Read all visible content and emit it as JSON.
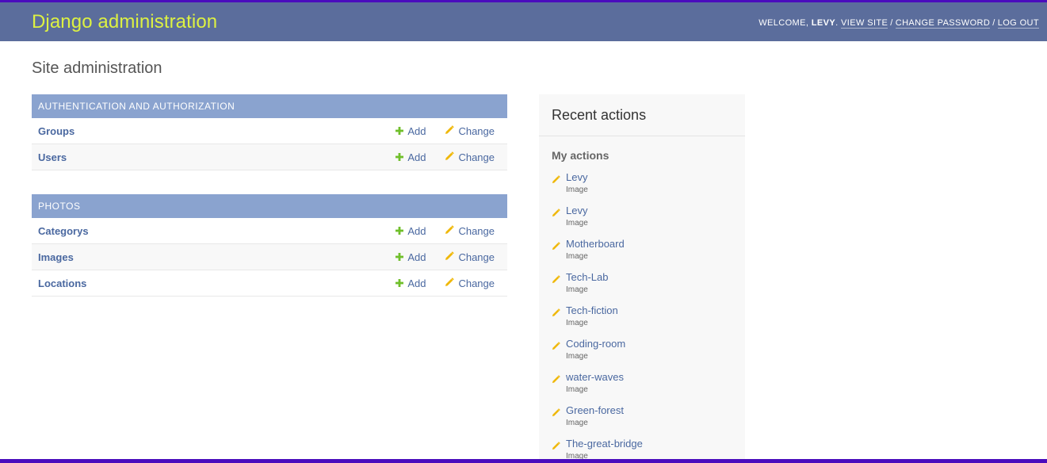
{
  "header": {
    "branding": "Django administration",
    "welcome_label": "Welcome,",
    "username": "Levy",
    "view_site": "View site",
    "change_password": "Change password",
    "log_out": "Log out"
  },
  "page_title": "Site administration",
  "modules": [
    {
      "caption": "Authentication and Authorization",
      "models": [
        {
          "name": "Groups",
          "add": "Add",
          "change": "Change"
        },
        {
          "name": "Users",
          "add": "Add",
          "change": "Change"
        }
      ]
    },
    {
      "caption": "Photos",
      "models": [
        {
          "name": "Categorys",
          "add": "Add",
          "change": "Change"
        },
        {
          "name": "Images",
          "add": "Add",
          "change": "Change"
        },
        {
          "name": "Locations",
          "add": "Add",
          "change": "Change"
        }
      ]
    }
  ],
  "recent_actions": {
    "title": "Recent actions",
    "subtitle": "My actions",
    "items": [
      {
        "name": "Levy",
        "type": "Image"
      },
      {
        "name": "Levy",
        "type": "Image"
      },
      {
        "name": "Motherboard",
        "type": "Image"
      },
      {
        "name": "Tech-Lab",
        "type": "Image"
      },
      {
        "name": "Tech-fiction",
        "type": "Image"
      },
      {
        "name": "Coding-room",
        "type": "Image"
      },
      {
        "name": "water-waves",
        "type": "Image"
      },
      {
        "name": "Green-forest",
        "type": "Image"
      },
      {
        "name": "The-great-bridge",
        "type": "Image"
      }
    ]
  },
  "colors": {
    "header_bg": "#5b6d9c",
    "branding": "#ddf142",
    "module_caption_bg": "#8aa3cf",
    "link": "#4a68a0",
    "add_icon": "#70bf2b",
    "change_icon": "#efb80b",
    "page_border": "#4a0cbd"
  },
  "icons": {
    "add": "plus-icon",
    "change": "pencil-icon"
  }
}
